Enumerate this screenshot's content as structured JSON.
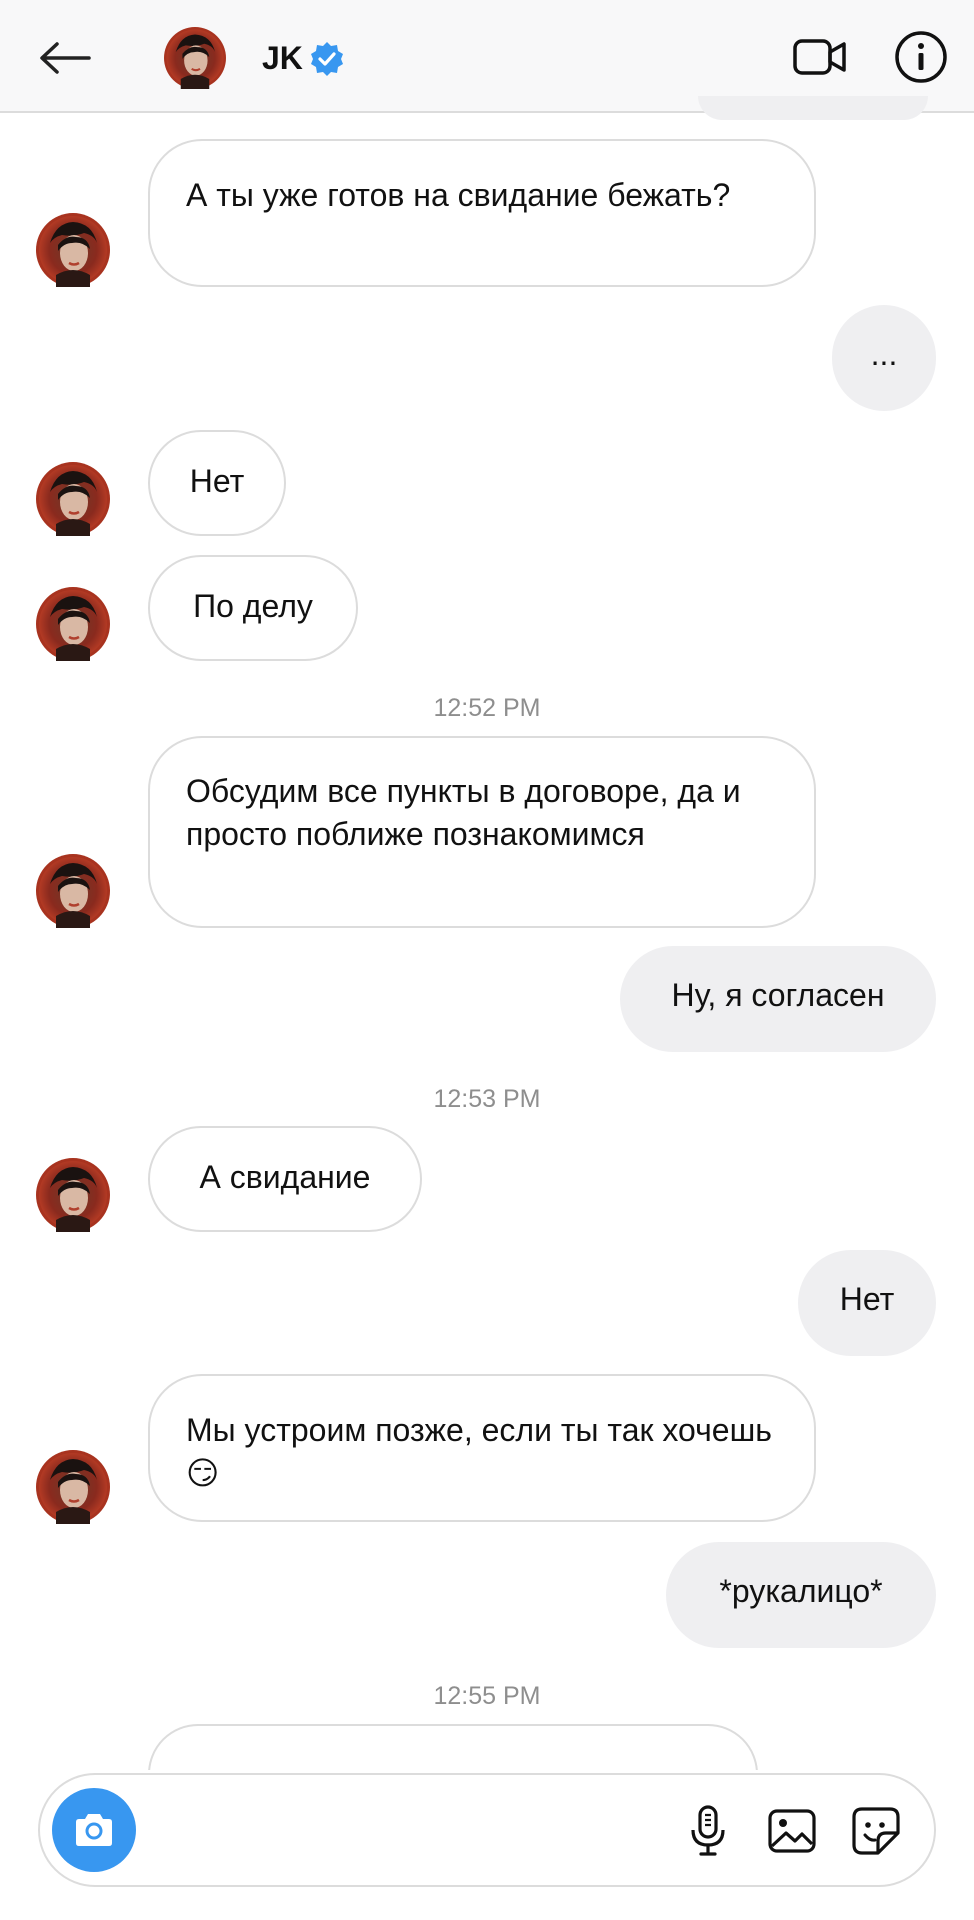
{
  "header": {
    "name": "JK",
    "verified_color": "#3897f0",
    "icons": [
      "back-arrow-icon",
      "avatar",
      "verified-badge-icon",
      "video-call-icon",
      "info-icon"
    ]
  },
  "messages": [
    {
      "side": "incoming",
      "text": "А ты уже готов на свидание бежать?"
    },
    {
      "side": "outgoing",
      "text": "..."
    },
    {
      "side": "incoming",
      "text": "Нет"
    },
    {
      "side": "incoming",
      "text": "По делу"
    },
    {
      "type": "timestamp",
      "text": "12:52 PM"
    },
    {
      "side": "incoming",
      "text": "Обсудим все пункты в договоре, да и просто поближе познакомимся"
    },
    {
      "side": "outgoing",
      "text": "Ну, я согласен"
    },
    {
      "type": "timestamp",
      "text": "12:53 PM"
    },
    {
      "side": "incoming",
      "text": "А свидание"
    },
    {
      "side": "outgoing",
      "text": "Нет"
    },
    {
      "side": "incoming",
      "text": "Мы устроим позже, если ты так хочешь😏"
    },
    {
      "side": "outgoing",
      "text": "*рукалицо*"
    },
    {
      "type": "timestamp",
      "text": "12:55 PM"
    }
  ],
  "composer": {
    "placeholder": "",
    "icons": [
      "camera-icon",
      "microphone-icon",
      "gallery-icon",
      "sticker-icon"
    ],
    "accent": "#3897f0"
  },
  "colors": {
    "incoming_bg": "#ffffff",
    "outgoing_bg": "#efeff1",
    "timestamp": "#8e8e8e"
  }
}
